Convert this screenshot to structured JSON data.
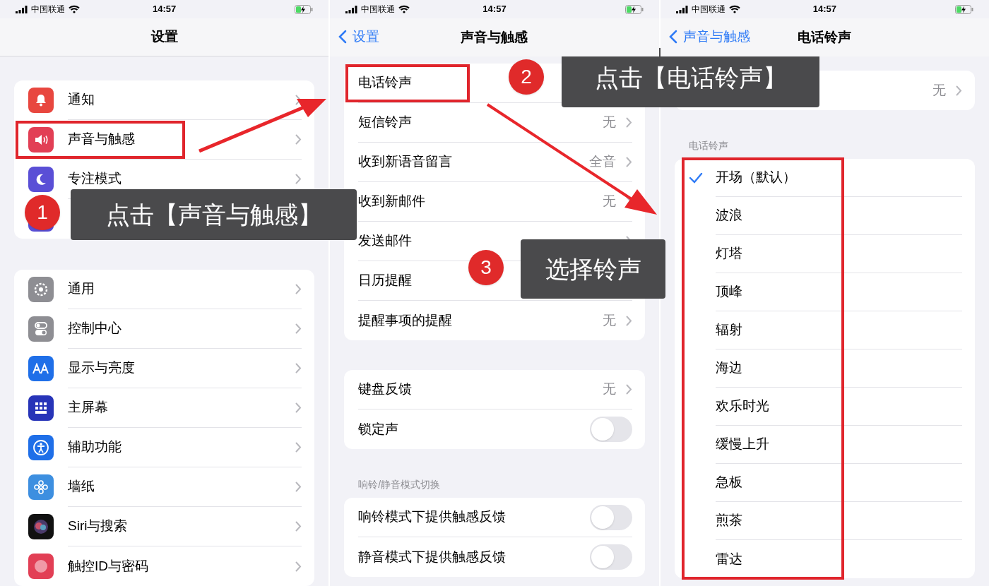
{
  "screens": [
    {
      "status": {
        "carrier": "中国联通",
        "time": "14:57"
      },
      "nav": {
        "title": "设置"
      },
      "groups": [
        {
          "rows": [
            {
              "kind": "link",
              "label": "通知",
              "highlighted": false
            },
            {
              "kind": "link",
              "label": "声音与触感",
              "highlighted": true
            },
            {
              "kind": "link",
              "label": "专注模式",
              "highlighted": false
            },
            {
              "kind": "link"
            }
          ]
        },
        {
          "rows": [
            {
              "kind": "link",
              "label": "通用",
              "highlighted": false
            },
            {
              "kind": "link",
              "label": "控制中心",
              "highlighted": false
            },
            {
              "kind": "link",
              "label": "显示与亮度",
              "highlighted": false
            },
            {
              "kind": "link",
              "label": "主屏幕",
              "highlighted": false
            },
            {
              "kind": "link",
              "label": "辅助功能",
              "highlighted": false
            },
            {
              "kind": "link",
              "label": "墙纸",
              "highlighted": false
            },
            {
              "kind": "link",
              "label": "Siri与搜索",
              "highlighted": false
            },
            {
              "kind": "link",
              "label": "触控ID与密码",
              "highlighted": false
            }
          ]
        }
      ]
    },
    {
      "status": {
        "carrier": "中国联通",
        "time": "14:57"
      },
      "nav": {
        "back": "设置",
        "title": "声音与触感"
      },
      "groups": [
        {
          "rows": [
            {
              "kind": "link",
              "label": "电话铃声",
              "highlighted": true
            },
            {
              "kind": "link",
              "label": "短信铃声",
              "value": "无",
              "highlighted": false
            },
            {
              "kind": "link",
              "label": "收到新语音留言",
              "value": "全音",
              "highlighted": false
            },
            {
              "kind": "link",
              "label": "收到新邮件",
              "value": "无",
              "highlighted": false
            },
            {
              "kind": "link",
              "label": "发送邮件",
              "highlighted": false
            },
            {
              "kind": "link",
              "label": "日历提醒",
              "highlighted": false
            },
            {
              "kind": "link",
              "label": "提醒事项的提醒",
              "value": "无",
              "highlighted": false
            }
          ]
        },
        {
          "rows": [
            {
              "kind": "link",
              "label": "键盘反馈",
              "value": "无",
              "highlighted": false
            },
            {
              "kind": "switch",
              "label": "锁定声",
              "on": false,
              "highlighted": false
            }
          ]
        },
        {
          "header": "响铃/静音模式切换",
          "rows": [
            {
              "kind": "switch",
              "label": "响铃模式下提供触感反馈",
              "on": false,
              "highlighted": false
            },
            {
              "kind": "switch",
              "label": "静音模式下提供触感反馈",
              "on": false,
              "highlighted": false
            }
          ]
        }
      ]
    },
    {
      "status": {
        "carrier": "中国联通",
        "time": "14:57"
      },
      "nav": {
        "back": "声音与触感",
        "title": "电话铃声"
      },
      "groups": [
        {
          "rows": [
            {
              "kind": "link",
              "value": "无",
              "highlighted": false
            }
          ]
        },
        {
          "header": "电话铃声",
          "highlighted": true,
          "rows": [
            {
              "kind": "option",
              "label": "开场（默认）",
              "selected": true
            },
            {
              "kind": "option",
              "label": "波浪",
              "selected": false
            },
            {
              "kind": "option",
              "label": "灯塔",
              "selected": false
            },
            {
              "kind": "option",
              "label": "顶峰",
              "selected": false
            },
            {
              "kind": "option",
              "label": "辐射",
              "selected": false
            },
            {
              "kind": "option",
              "label": "海边",
              "selected": false
            },
            {
              "kind": "option",
              "label": "欢乐时光",
              "selected": false
            },
            {
              "kind": "option",
              "label": "缓慢上升",
              "selected": false
            },
            {
              "kind": "option",
              "label": "急板",
              "selected": false
            },
            {
              "kind": "option",
              "label": "煎茶",
              "selected": false
            },
            {
              "kind": "option",
              "label": "雷达",
              "selected": false
            }
          ]
        }
      ]
    }
  ],
  "callouts": [
    {
      "number": "1",
      "text": "点击【声音与触感】"
    },
    {
      "number": "2",
      "text": "点击【电话铃声】"
    },
    {
      "number": "3",
      "text": "选择铃声"
    }
  ]
}
